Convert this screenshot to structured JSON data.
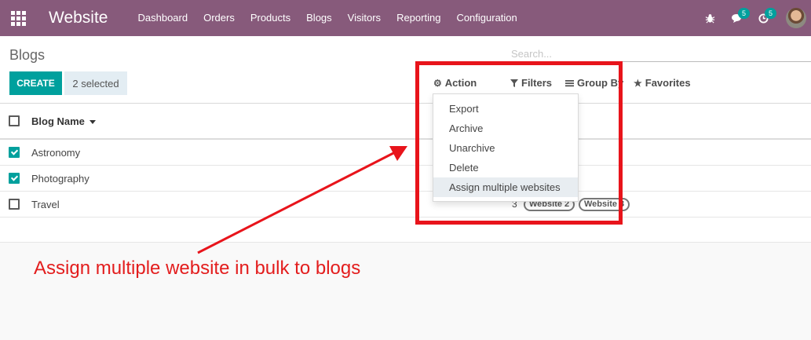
{
  "navbar": {
    "app_title": "Website",
    "menu": [
      "Dashboard",
      "Orders",
      "Products",
      "Blogs",
      "Visitors",
      "Reporting",
      "Configuration"
    ],
    "chat_badge": "5",
    "activity_badge": "5"
  },
  "control_panel": {
    "breadcrumb": "Blogs",
    "search_placeholder": "Search...",
    "create_label": "CREATE",
    "selected_label": "2 selected",
    "action_label": "Action",
    "filters_label": "Filters",
    "group_by_label": "Group By",
    "favorites_label": "Favorites"
  },
  "action_menu": {
    "items": [
      "Export",
      "Archive",
      "Unarchive",
      "Delete",
      "Assign multiple websites"
    ],
    "active_index": 4
  },
  "list": {
    "column_header": "Blog Name",
    "rows": [
      {
        "name": "Astronomy",
        "checked": true
      },
      {
        "name": "Photography",
        "checked": true
      },
      {
        "name": "Travel",
        "checked": false,
        "count": "3",
        "tags": [
          "Website 2",
          "Website 3"
        ]
      }
    ]
  },
  "annotation": {
    "text": "Assign multiple website in bulk to blogs",
    "color": "#e31d1d"
  },
  "colors": {
    "navbar": "#875a7b",
    "primary": "#00a09d",
    "highlight": "#e8141b"
  }
}
